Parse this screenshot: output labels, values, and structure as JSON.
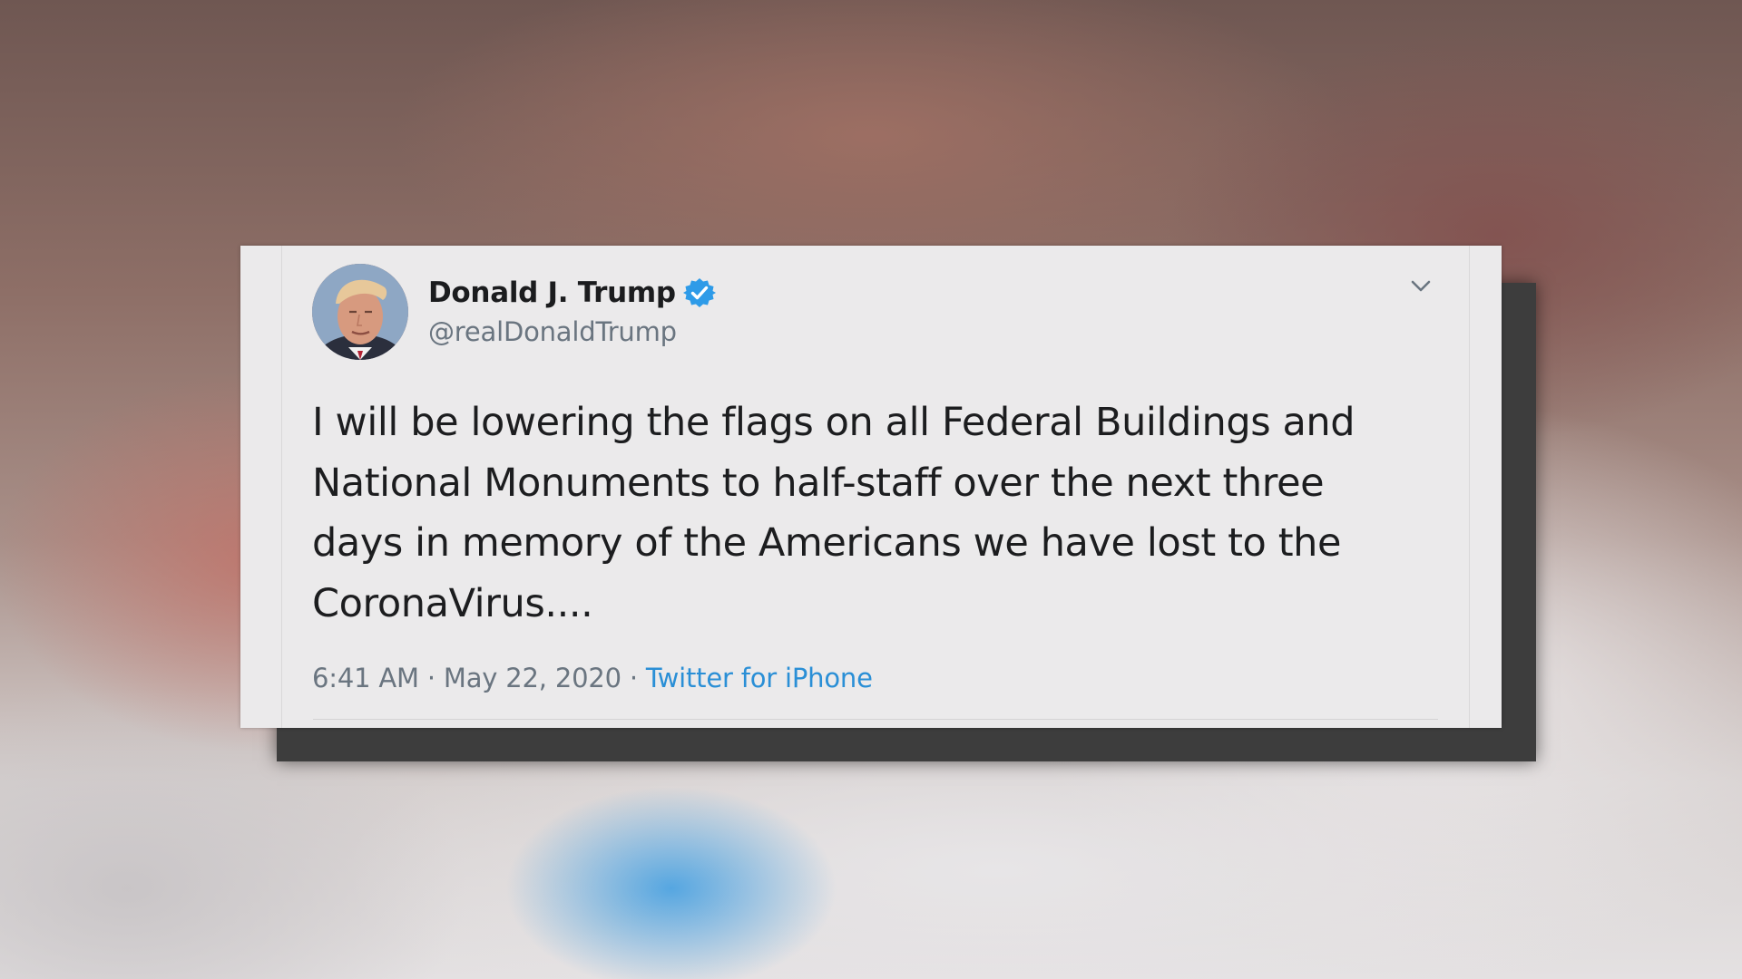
{
  "tweet": {
    "display_name": "Donald J. Trump",
    "handle": "@realDonaldTrump",
    "verified": true,
    "text": "I will be lowering the flags on all Federal Buildings and\nNational Monuments to half-staff over the next three\ndays in memory of the Americans we have lost to the\nCoronaVirus....",
    "time": "6:41 AM",
    "separator": "·",
    "date": "May 22, 2020",
    "source": "Twitter for iPhone"
  },
  "icons": {
    "avatar": "profile-photo",
    "verified": "verified-badge-icon",
    "menu": "chevron-down-icon"
  },
  "colors": {
    "verified_badge": "#2e9be8",
    "link": "#2a8fd6",
    "secondary_text": "#6a7580",
    "card_background": "#ebeaeb"
  }
}
